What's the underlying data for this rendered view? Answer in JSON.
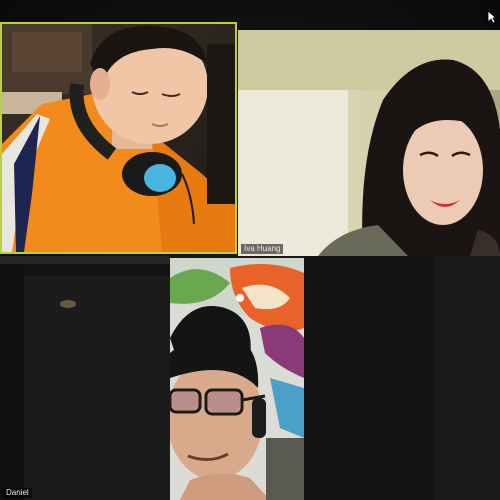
{
  "meeting": {
    "view": "gallery",
    "participants": [
      {
        "id": "p1",
        "label": "",
        "active_speaker": true
      },
      {
        "id": "p2",
        "label": "Iva Huang",
        "active_speaker": false
      },
      {
        "id": "p3",
        "label": "Daniel",
        "active_speaker": false
      },
      {
        "id": "p4",
        "label": "",
        "active_speaker": false
      }
    ]
  },
  "colors": {
    "active_speaker_border": "#b8d23a",
    "background": "#0d0d0d"
  },
  "icons": {
    "cursor": "mouse-pointer-icon"
  }
}
